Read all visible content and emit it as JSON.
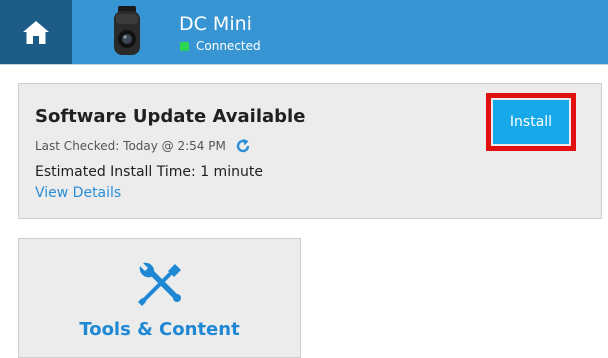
{
  "header": {
    "device_name": "DC Mini",
    "status": "Connected",
    "home_icon": "home-icon",
    "device_image": "dashcam-device-image",
    "colors": {
      "bar": "#3795d3",
      "home_bg": "#1c5c86",
      "status_dot": "#2bd652"
    }
  },
  "update": {
    "title": "Software Update Available",
    "last_checked": "Last Checked: Today @ 2:54 PM",
    "refresh_icon": "refresh-icon",
    "install_time": "Estimated Install Time: 1 minute",
    "view_details": "View Details",
    "install_label": "Install",
    "colors": {
      "install_button": "#17a8ea",
      "highlight": "#e01010",
      "link": "#2a8ed8"
    }
  },
  "tools": {
    "label": "Tools & Content",
    "icon": "tools-icon"
  }
}
